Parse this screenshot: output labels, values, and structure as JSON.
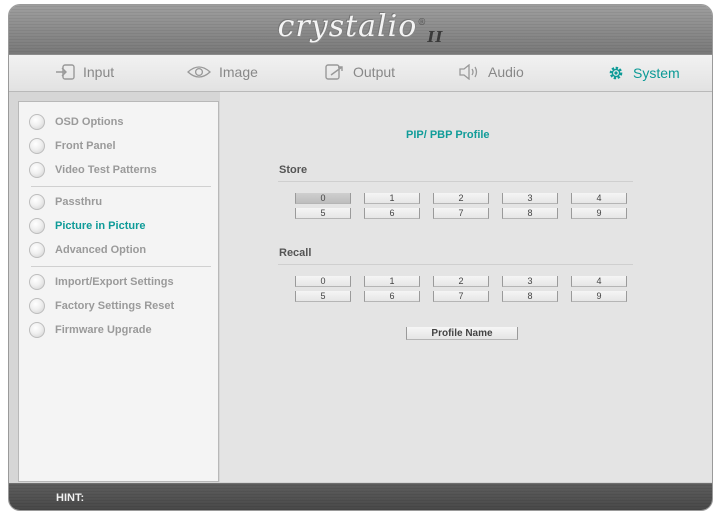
{
  "app": {
    "logo_text": "crystalio",
    "logo_model": "II",
    "logo_mark": "®"
  },
  "nav": {
    "items": [
      {
        "label": "Input",
        "icon": "input-icon"
      },
      {
        "label": "Image",
        "icon": "eye-icon"
      },
      {
        "label": "Output",
        "icon": "output-icon"
      },
      {
        "label": "Audio",
        "icon": "speaker-icon"
      },
      {
        "label": "System",
        "icon": "gear-icon",
        "active": true
      }
    ],
    "active_color": "#0b9a96"
  },
  "sidebar": {
    "items": [
      {
        "label": "OSD Options"
      },
      {
        "label": "Front Panel"
      },
      {
        "label": "Video Test Patterns"
      },
      {
        "label": "Passthru"
      },
      {
        "label": "Picture in Picture",
        "active": true
      },
      {
        "label": "Advanced Option"
      },
      {
        "label": "Import/Export Settings"
      },
      {
        "label": "Factory Settings Reset"
      },
      {
        "label": "Firmware Upgrade"
      }
    ]
  },
  "main": {
    "title": "PIP/ PBP Profile",
    "store": {
      "label": "Store",
      "buttons": [
        "0",
        "1",
        "2",
        "3",
        "4",
        "5",
        "6",
        "7",
        "8",
        "9"
      ],
      "selected": "0"
    },
    "recall": {
      "label": "Recall",
      "buttons": [
        "0",
        "1",
        "2",
        "3",
        "4",
        "5",
        "6",
        "7",
        "8",
        "9"
      ]
    },
    "profile_name_button": "Profile Name"
  },
  "hint": {
    "label": "HINT:",
    "text": ""
  }
}
